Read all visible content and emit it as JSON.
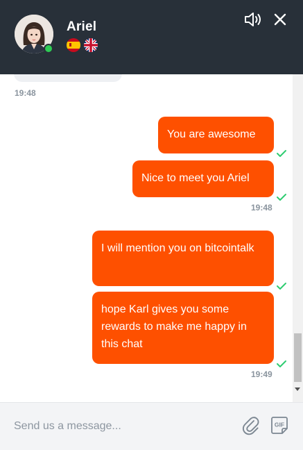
{
  "header": {
    "agent_name": "Ariel",
    "status": "online",
    "languages": [
      "Spanish",
      "English"
    ],
    "sound_icon": "speaker-icon",
    "close_icon": "close-icon"
  },
  "messages": [
    {
      "type": "timestamp",
      "text": "19:48"
    },
    {
      "type": "outgoing",
      "text": "You are awesome",
      "delivered": true
    },
    {
      "type": "outgoing",
      "text": "Nice to meet you Ariel",
      "delivered": true
    },
    {
      "type": "timestamp",
      "text": "19:48"
    },
    {
      "type": "outgoing",
      "text": "I will mention you on bitcointalk",
      "delivered": true
    },
    {
      "type": "outgoing",
      "text": "hope Karl gives you some rewards to make me happy in this chat",
      "delivered": true
    },
    {
      "type": "timestamp",
      "text": "19:49"
    }
  ],
  "composer": {
    "placeholder": "Send us a message...",
    "attach_icon": "paperclip-icon",
    "gif_label": "GIF"
  },
  "colors": {
    "header_bg": "#283039",
    "bubble_bg": "#fe5000",
    "check": "#2ecc71",
    "online": "#2ecc54"
  }
}
